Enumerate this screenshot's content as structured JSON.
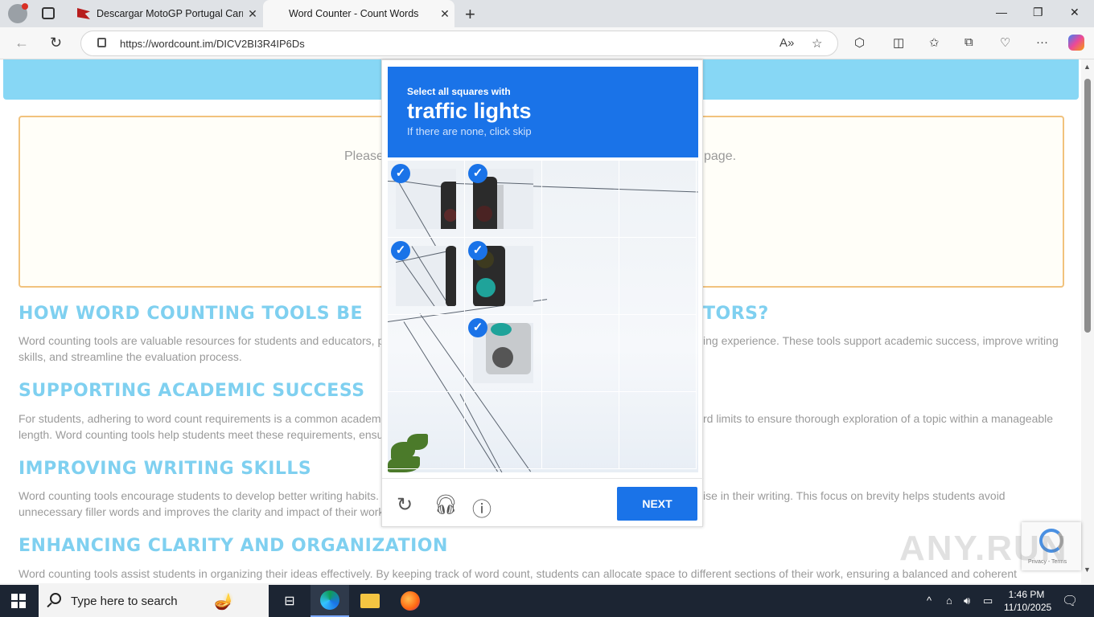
{
  "browser": {
    "tabs": [
      {
        "title": "Descargar MotoGP Portugal Carre",
        "active": false
      },
      {
        "title": "Word Counter - Count Words",
        "active": true
      }
    ],
    "url": "https://wordcount.im/DICV2BI3R4IP6Ds"
  },
  "page": {
    "placeholder_left": "Please",
    "placeholder_right": "page.",
    "sections": [
      {
        "heading": "HOW WORD COUNTING TOOLS BE",
        "heading_tail": "TORS?",
        "text_a": "Word counting tools are valuable resources for students and educators, p",
        "text_b": "ing experience. These tools support academic success, improve writing",
        "text_c": "skills, and streamline the evaluation process."
      },
      {
        "heading": "SUPPORTING ACADEMIC SUCCESS",
        "text_a": "For students, adhering to word count requirements is a common academ",
        "text_b": "rd limits to ensure thorough exploration of a topic within a manageable",
        "text_c": "length. Word counting tools help students meet these requirements, ensu"
      },
      {
        "heading": "IMPROVING WRITING SKILLS",
        "text_a": "Word counting tools encourage students to develop better writing habits.",
        "text_b": "ise in their writing. This focus on brevity helps students avoid",
        "text_c": "unnecessary filler words and improves the clarity and impact of their work"
      },
      {
        "heading": "ENHANCING CLARITY AND ORGANIZATION",
        "text_a": "Word counting tools assist students in organizing their ideas effectively. By keeping track of word count, students can allocate space to different sections of their work, ensuring a balanced and coherent"
      }
    ]
  },
  "captcha": {
    "line1": "Select all squares with",
    "line2": "traffic lights",
    "line3": "If there are none, click skip",
    "next_label": "NEXT",
    "selected_cells": [
      0,
      1,
      4,
      5,
      9
    ],
    "icons": [
      "reload-icon",
      "audio-icon",
      "info-icon"
    ]
  },
  "recaptcha_badge": {
    "text": "Privacy - Terms"
  },
  "watermark": "ANY.RUN",
  "taskbar": {
    "search_placeholder": "Type here to search",
    "time": "1:46 PM",
    "date": "11/10/2025"
  }
}
